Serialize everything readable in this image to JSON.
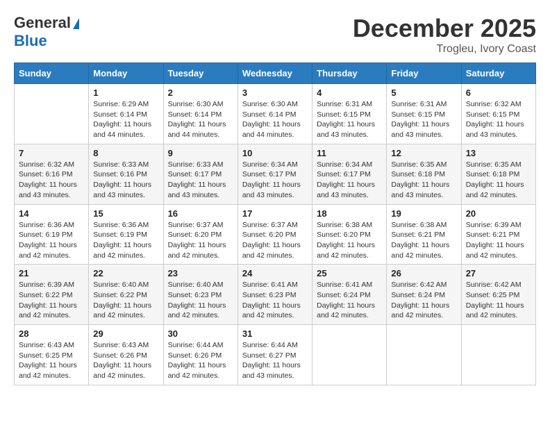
{
  "header": {
    "logo_general": "General",
    "logo_blue": "Blue",
    "month_title": "December 2025",
    "location": "Trogleu, Ivory Coast"
  },
  "days_of_week": [
    "Sunday",
    "Monday",
    "Tuesday",
    "Wednesday",
    "Thursday",
    "Friday",
    "Saturday"
  ],
  "weeks": [
    [
      {
        "day": "",
        "info": ""
      },
      {
        "day": "1",
        "info": "Sunrise: 6:29 AM\nSunset: 6:14 PM\nDaylight: 11 hours\nand 44 minutes."
      },
      {
        "day": "2",
        "info": "Sunrise: 6:30 AM\nSunset: 6:14 PM\nDaylight: 11 hours\nand 44 minutes."
      },
      {
        "day": "3",
        "info": "Sunrise: 6:30 AM\nSunset: 6:14 PM\nDaylight: 11 hours\nand 44 minutes."
      },
      {
        "day": "4",
        "info": "Sunrise: 6:31 AM\nSunset: 6:15 PM\nDaylight: 11 hours\nand 43 minutes."
      },
      {
        "day": "5",
        "info": "Sunrise: 6:31 AM\nSunset: 6:15 PM\nDaylight: 11 hours\nand 43 minutes."
      },
      {
        "day": "6",
        "info": "Sunrise: 6:32 AM\nSunset: 6:15 PM\nDaylight: 11 hours\nand 43 minutes."
      }
    ],
    [
      {
        "day": "7",
        "info": "Sunrise: 6:32 AM\nSunset: 6:16 PM\nDaylight: 11 hours\nand 43 minutes."
      },
      {
        "day": "8",
        "info": "Sunrise: 6:33 AM\nSunset: 6:16 PM\nDaylight: 11 hours\nand 43 minutes."
      },
      {
        "day": "9",
        "info": "Sunrise: 6:33 AM\nSunset: 6:17 PM\nDaylight: 11 hours\nand 43 minutes."
      },
      {
        "day": "10",
        "info": "Sunrise: 6:34 AM\nSunset: 6:17 PM\nDaylight: 11 hours\nand 43 minutes."
      },
      {
        "day": "11",
        "info": "Sunrise: 6:34 AM\nSunset: 6:17 PM\nDaylight: 11 hours\nand 43 minutes."
      },
      {
        "day": "12",
        "info": "Sunrise: 6:35 AM\nSunset: 6:18 PM\nDaylight: 11 hours\nand 43 minutes."
      },
      {
        "day": "13",
        "info": "Sunrise: 6:35 AM\nSunset: 6:18 PM\nDaylight: 11 hours\nand 42 minutes."
      }
    ],
    [
      {
        "day": "14",
        "info": "Sunrise: 6:36 AM\nSunset: 6:19 PM\nDaylight: 11 hours\nand 42 minutes."
      },
      {
        "day": "15",
        "info": "Sunrise: 6:36 AM\nSunset: 6:19 PM\nDaylight: 11 hours\nand 42 minutes."
      },
      {
        "day": "16",
        "info": "Sunrise: 6:37 AM\nSunset: 6:20 PM\nDaylight: 11 hours\nand 42 minutes."
      },
      {
        "day": "17",
        "info": "Sunrise: 6:37 AM\nSunset: 6:20 PM\nDaylight: 11 hours\nand 42 minutes."
      },
      {
        "day": "18",
        "info": "Sunrise: 6:38 AM\nSunset: 6:20 PM\nDaylight: 11 hours\nand 42 minutes."
      },
      {
        "day": "19",
        "info": "Sunrise: 6:38 AM\nSunset: 6:21 PM\nDaylight: 11 hours\nand 42 minutes."
      },
      {
        "day": "20",
        "info": "Sunrise: 6:39 AM\nSunset: 6:21 PM\nDaylight: 11 hours\nand 42 minutes."
      }
    ],
    [
      {
        "day": "21",
        "info": "Sunrise: 6:39 AM\nSunset: 6:22 PM\nDaylight: 11 hours\nand 42 minutes."
      },
      {
        "day": "22",
        "info": "Sunrise: 6:40 AM\nSunset: 6:22 PM\nDaylight: 11 hours\nand 42 minutes."
      },
      {
        "day": "23",
        "info": "Sunrise: 6:40 AM\nSunset: 6:23 PM\nDaylight: 11 hours\nand 42 minutes."
      },
      {
        "day": "24",
        "info": "Sunrise: 6:41 AM\nSunset: 6:23 PM\nDaylight: 11 hours\nand 42 minutes."
      },
      {
        "day": "25",
        "info": "Sunrise: 6:41 AM\nSunset: 6:24 PM\nDaylight: 11 hours\nand 42 minutes."
      },
      {
        "day": "26",
        "info": "Sunrise: 6:42 AM\nSunset: 6:24 PM\nDaylight: 11 hours\nand 42 minutes."
      },
      {
        "day": "27",
        "info": "Sunrise: 6:42 AM\nSunset: 6:25 PM\nDaylight: 11 hours\nand 42 minutes."
      }
    ],
    [
      {
        "day": "28",
        "info": "Sunrise: 6:43 AM\nSunset: 6:25 PM\nDaylight: 11 hours\nand 42 minutes."
      },
      {
        "day": "29",
        "info": "Sunrise: 6:43 AM\nSunset: 6:26 PM\nDaylight: 11 hours\nand 42 minutes."
      },
      {
        "day": "30",
        "info": "Sunrise: 6:44 AM\nSunset: 6:26 PM\nDaylight: 11 hours\nand 42 minutes."
      },
      {
        "day": "31",
        "info": "Sunrise: 6:44 AM\nSunset: 6:27 PM\nDaylight: 11 hours\nand 43 minutes."
      },
      {
        "day": "",
        "info": ""
      },
      {
        "day": "",
        "info": ""
      },
      {
        "day": "",
        "info": ""
      }
    ]
  ]
}
